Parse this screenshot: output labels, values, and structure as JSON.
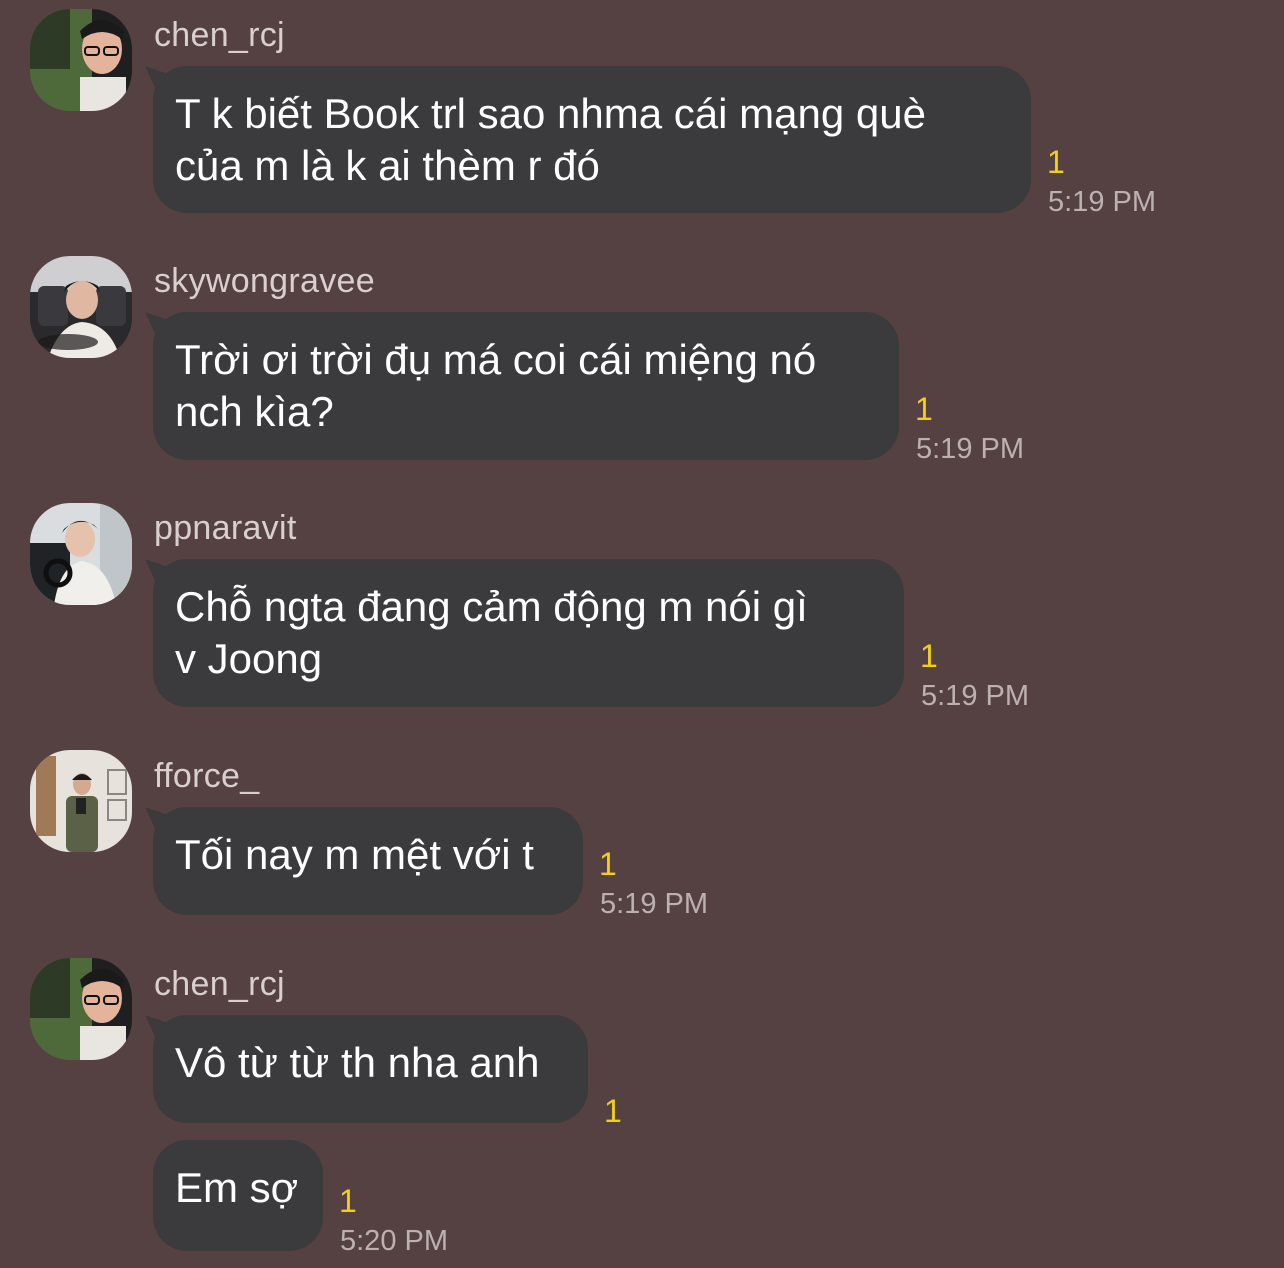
{
  "messages": [
    {
      "sender": "chen_rcj",
      "avatar_icon": "user-avatar-icon",
      "bubbles": [
        {
          "text": "T k biết Book trl sao nhma cái mạng què\ncủa m là k ai thèm r đó",
          "unread": "1",
          "time": "5:19 PM"
        }
      ]
    },
    {
      "sender": "skywongravee",
      "avatar_icon": "user-avatar-icon",
      "bubbles": [
        {
          "text": "Trời ơi trời đụ má coi cái miệng nó\nnch kìa?",
          "unread": "1",
          "time": "5:19 PM"
        }
      ]
    },
    {
      "sender": "ppnaravit",
      "avatar_icon": "user-avatar-icon",
      "bubbles": [
        {
          "text": "Chỗ ngta đang cảm động m nói gì\nv Joong",
          "unread": "1",
          "time": "5:19 PM"
        }
      ]
    },
    {
      "sender": "fforce_",
      "avatar_icon": "user-avatar-icon",
      "bubbles": [
        {
          "text": "Tối nay m mệt với t",
          "unread": "1",
          "time": "5:19 PM"
        }
      ]
    },
    {
      "sender": "chen_rcj",
      "avatar_icon": "user-avatar-icon",
      "bubbles": [
        {
          "text": "Vô từ từ th nha anh",
          "unread": "1",
          "time": ""
        },
        {
          "text": "Em sợ",
          "unread": "1",
          "time": "5:20 PM"
        }
      ]
    }
  ],
  "colors": {
    "background": "#554142",
    "bubble": "#3b3a3c",
    "unread": "#f2d01a",
    "timestamp": "#bcb0b1"
  }
}
